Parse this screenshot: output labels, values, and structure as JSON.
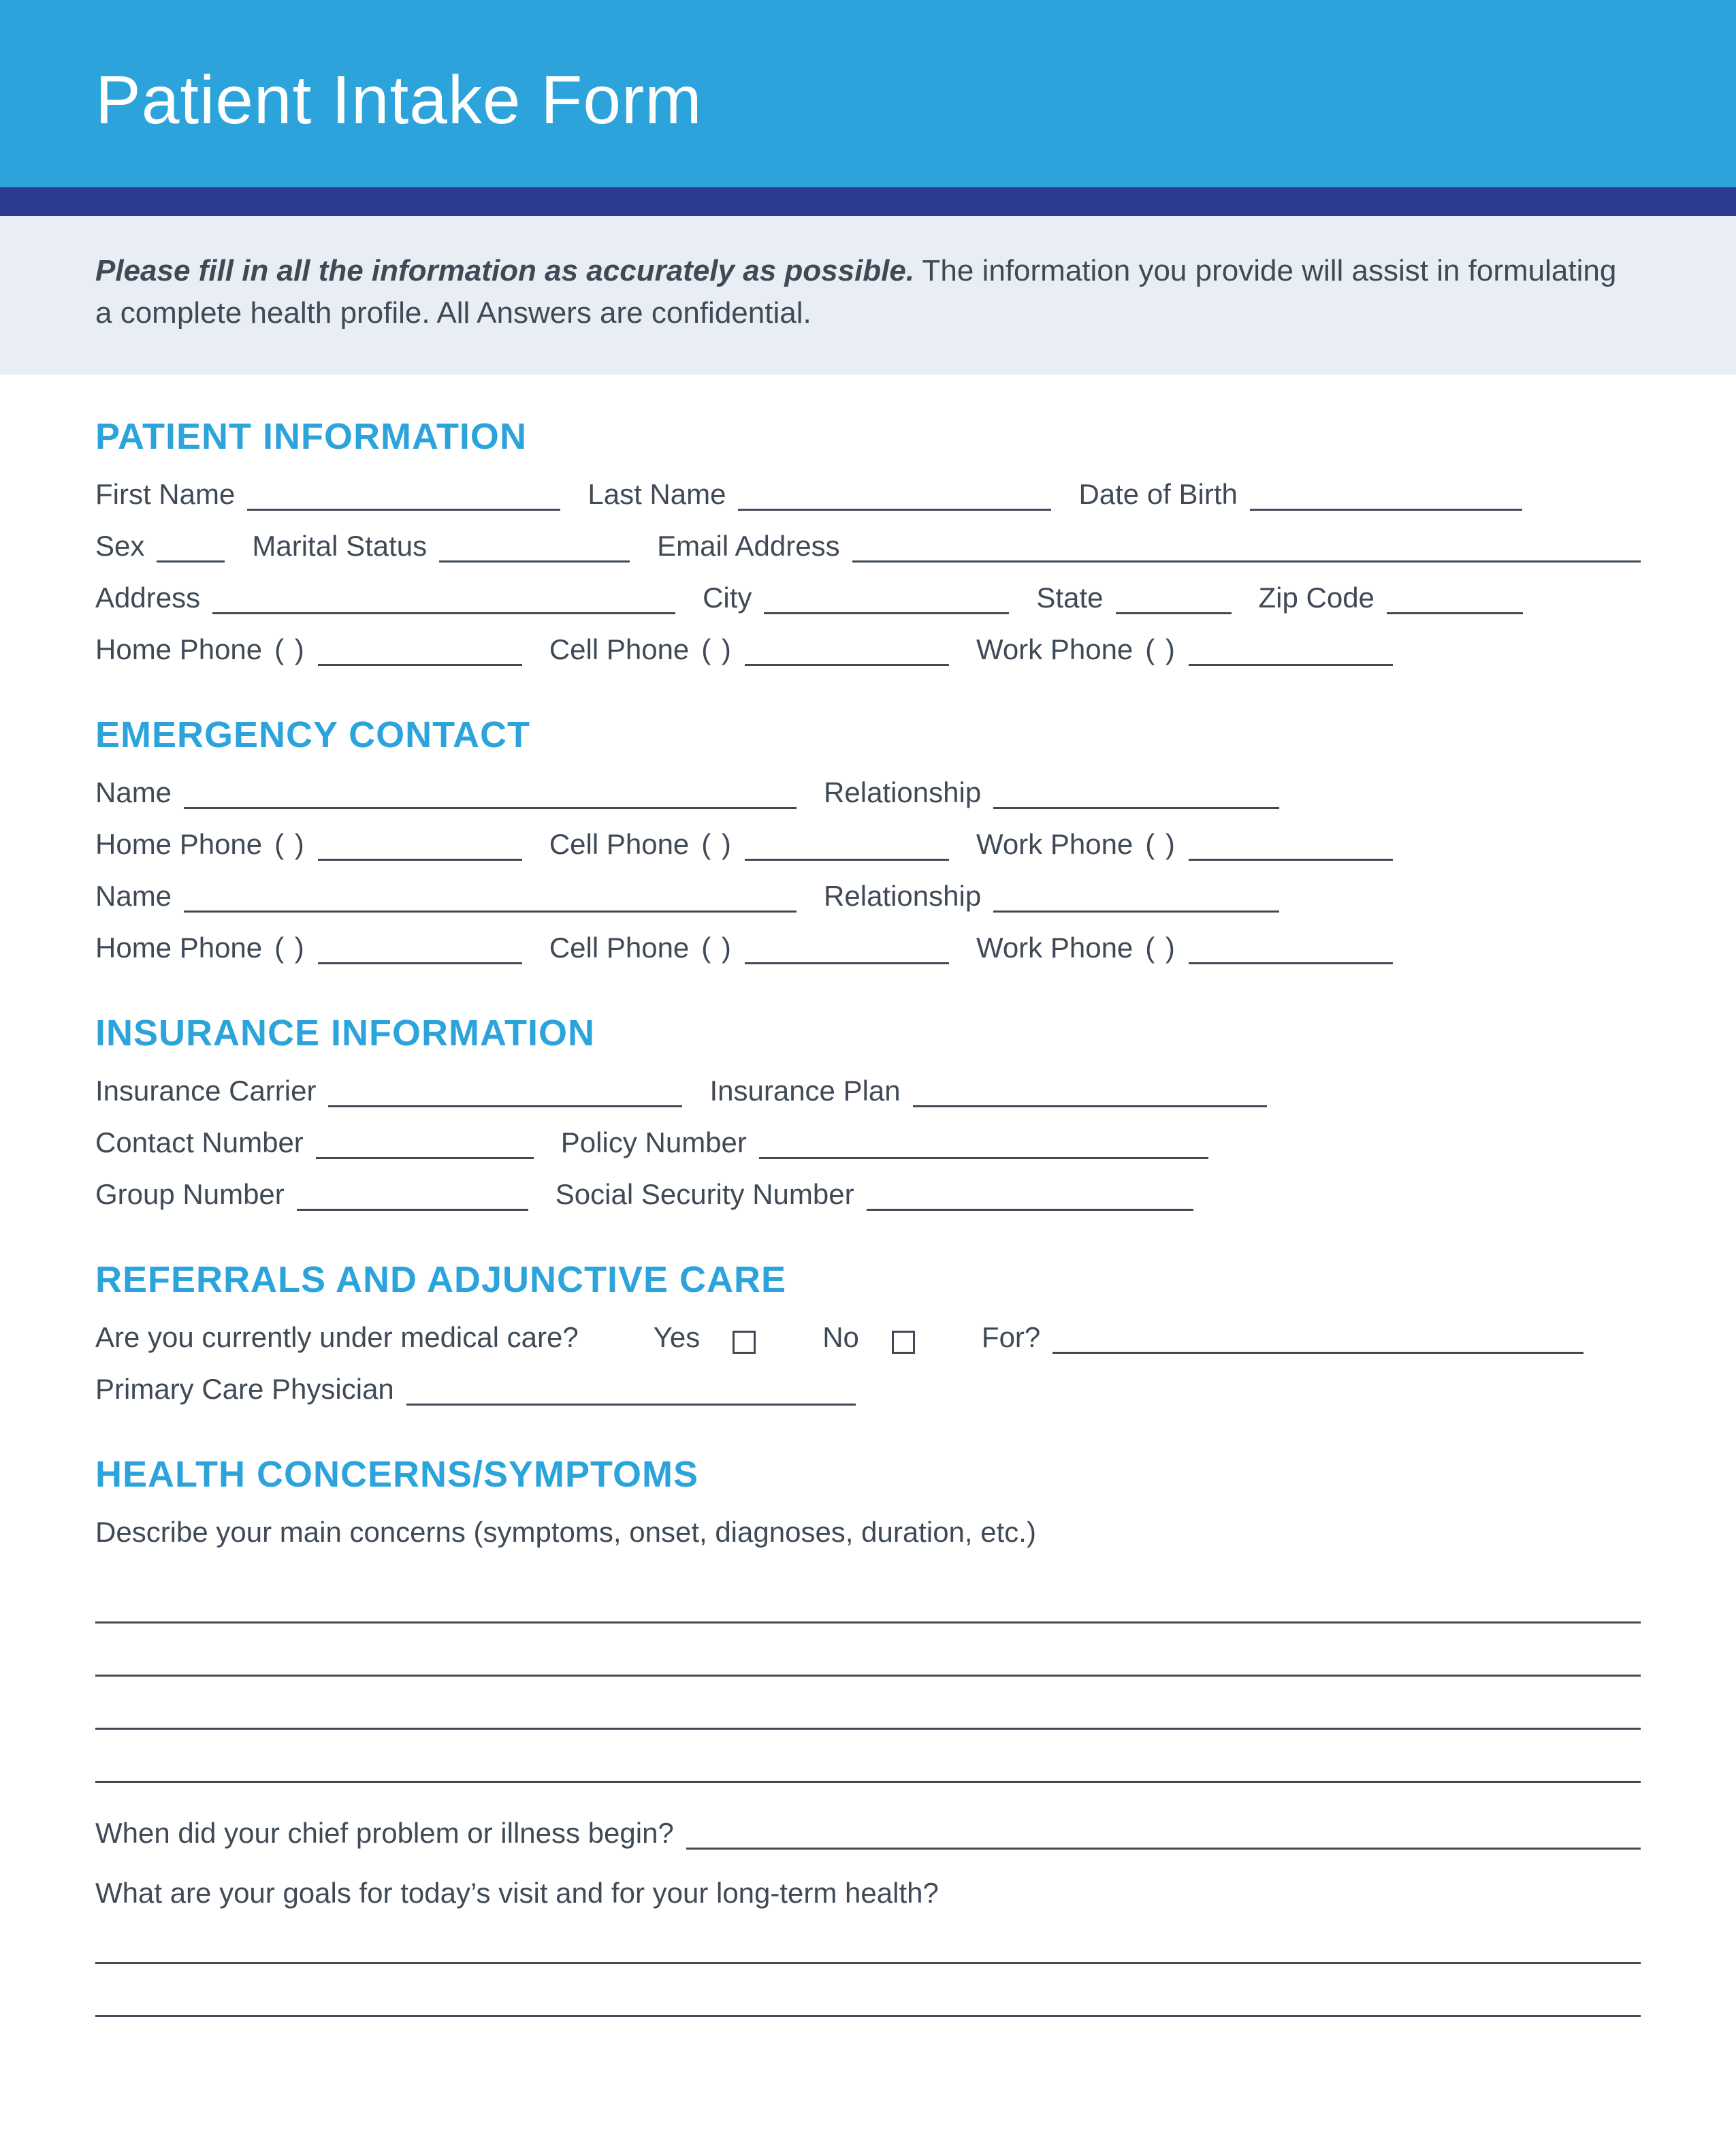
{
  "header": {
    "title": "Patient Intake Form"
  },
  "intro": {
    "bold": "Please fill in all the information as accurately as possible.",
    "rest": " The information you provide will assist in formulating a complete health profile. All Answers are confidential."
  },
  "sections": {
    "patient": {
      "title": "PATIENT INFORMATION",
      "first_name": "First Name",
      "last_name": "Last Name",
      "dob": "Date of Birth",
      "sex": "Sex",
      "marital": "Marital Status",
      "email": "Email Address",
      "address": "Address",
      "city": "City",
      "state": "State",
      "zip": "Zip Code",
      "home_phone": "Home Phone",
      "cell_phone": "Cell Phone",
      "work_phone": "Work Phone",
      "paren": "(      )"
    },
    "emergency": {
      "title": "EMERGENCY CONTACT",
      "name": "Name",
      "relationship": "Relationship",
      "home_phone": "Home Phone",
      "cell_phone": "Cell Phone",
      "work_phone": "Work Phone",
      "paren": "(      )"
    },
    "insurance": {
      "title": "INSURANCE INFORMATION",
      "carrier": "Insurance Carrier",
      "plan": "Insurance Plan",
      "contact": "Contact Number",
      "policy": "Policy Number",
      "group": "Group Number",
      "ssn": "Social Security Number"
    },
    "referrals": {
      "title": "REFERRALS AND ADJUNCTIVE CARE",
      "question": "Are you currently under medical care?",
      "yes": "Yes",
      "no": "No",
      "for": "For?",
      "pcp": "Primary Care Physician"
    },
    "health": {
      "title": "HEALTH CONCERNS/SYMPTOMS",
      "describe": "Describe your main concerns (symptoms, onset, diagnoses, duration, etc.)",
      "when": "When did your chief problem or illness begin?",
      "goals": "What are your goals for today’s visit and for your long-term health?"
    }
  }
}
